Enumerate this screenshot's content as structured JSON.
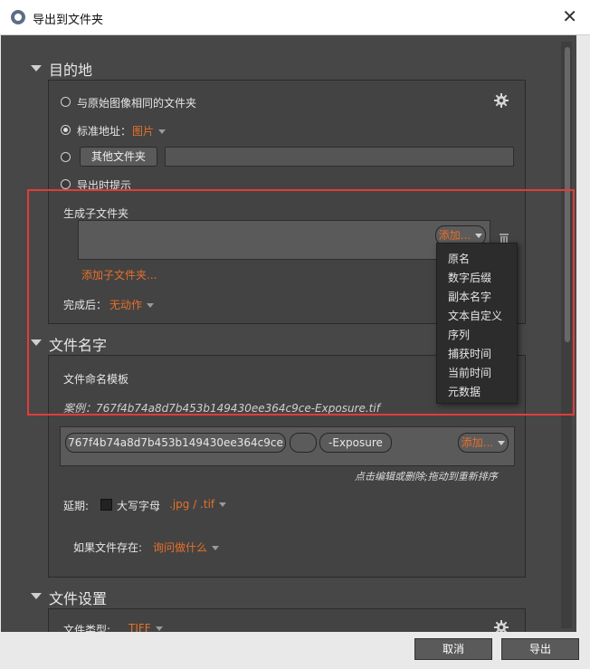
{
  "window": {
    "title": "导出到文件夹"
  },
  "sections": {
    "destination": {
      "title": "目的地"
    },
    "filename": {
      "title": "文件名字"
    },
    "file_settings": {
      "title": "文件设置"
    }
  },
  "destination": {
    "same_folder_label": "与原始图像相同的文件夹",
    "standard_label": "标准地址：",
    "standard_value": "图片",
    "other_folder_button": "其他文件夹",
    "other_folder_value": "",
    "ask_label": "导出时提示",
    "subfolder_label": "生成子文件夹",
    "add_button": "添加...",
    "add_subfolder_link": "添加子文件夹...",
    "after_label": "完成后：",
    "after_value": "无动作"
  },
  "add_menu": {
    "items": [
      "原名",
      "数字后缀",
      "副本名字",
      "文本自定义",
      "序列",
      "捕获时间",
      "当前时间",
      "元数据"
    ]
  },
  "filename": {
    "template_label": "文件命名模板",
    "example_text": "案例：767f4b74a8d7b453b149430ee364c9ce-Exposure.tif",
    "token_name": "767f4b74a8d7b453b149430ee364c9ce",
    "token_blank": "",
    "token_suffix": "-Exposure",
    "add_button": "添加...",
    "hint_text": "点击编辑或删除;拖动到重新排序",
    "extension_label": "延期:",
    "uppercase_label": "大写字母",
    "extension_value": ".jpg / .tif",
    "exists_label": "如果文件存在:",
    "exists_value": "询问做什么"
  },
  "file_settings": {
    "type_label": "文件类型:",
    "type_value": "TIFF"
  },
  "footer": {
    "cancel": "取消",
    "export": "导出"
  }
}
